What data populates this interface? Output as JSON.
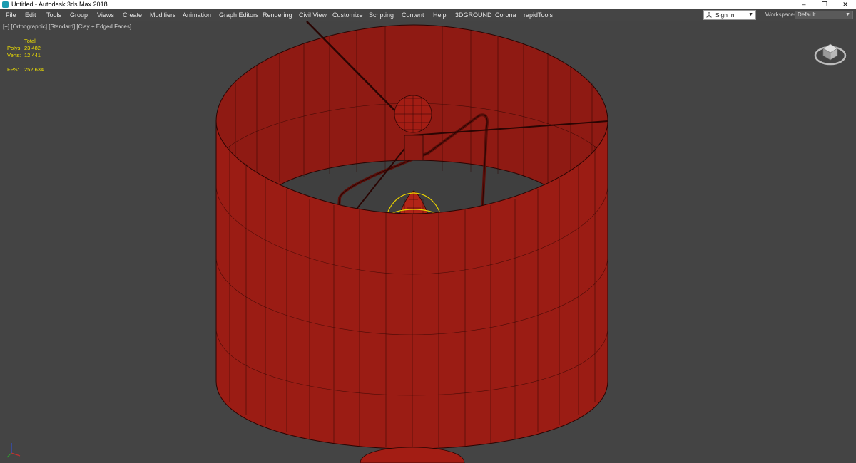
{
  "window": {
    "title": "Untitled - Autodesk 3ds Max 2018",
    "minimize_glyph": "–",
    "restore_glyph": "❐",
    "close_glyph": "✕"
  },
  "menu": {
    "items": [
      "File",
      "Edit",
      "Tools",
      "Group",
      "Views",
      "Create",
      "Modifiers",
      "Animation",
      "Graph Editors",
      "Rendering",
      "Civil View",
      "Customize",
      "Scripting",
      "Content",
      "Help",
      "3DGROUND",
      "Corona",
      "rapidTools"
    ]
  },
  "account": {
    "sign_in_label": "Sign In",
    "workspaces_label": "Workspaces:",
    "workspace_value": "Default"
  },
  "viewport": {
    "label": "[+] [Orthographic] [Standard] [Clay + Edged Faces]",
    "stats": {
      "header": "Total",
      "polys_label": "Polys:",
      "polys_value": "23 482",
      "verts_label": "Verts:",
      "verts_value": "12 441",
      "fps_label": "FPS:",
      "fps_value": "252,634"
    }
  },
  "colors": {
    "viewport_bg": "#444444",
    "model_red": "#9b1c14",
    "wire": "#2a0503",
    "selection_yellow": "#e8d000",
    "stats_yellow": "#f0e000"
  },
  "icons": [
    "app-icon",
    "user-icon",
    "viewcube-icon",
    "axis-tripod-icon"
  ]
}
